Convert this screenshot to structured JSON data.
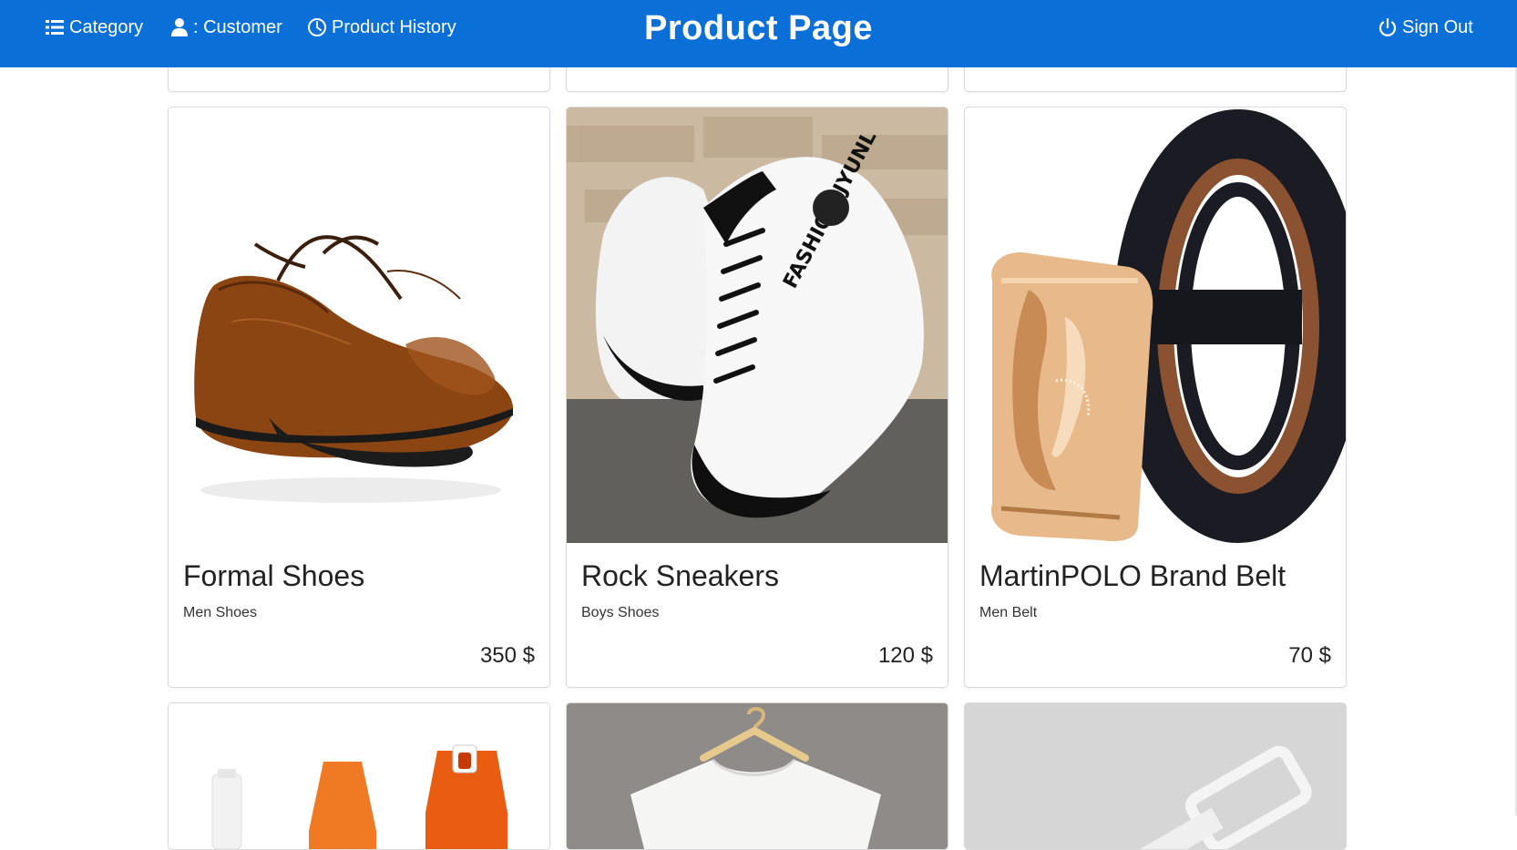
{
  "header": {
    "title": "Product Page",
    "nav": {
      "category": "Category",
      "customer": ": Customer",
      "history": "Product History",
      "signout": "Sign Out"
    },
    "background_color": "#0a6fd6"
  },
  "products": [
    {
      "name": "Formal Shoes",
      "category": "Men Shoes",
      "price": "350 $",
      "image_icon": "brown-leather-shoe"
    },
    {
      "name": "Rock Sneakers",
      "category": "Boys Shoes",
      "price": "120 $",
      "image_icon": "white-high-top-sneaker"
    },
    {
      "name": "MartinPOLO Brand Belt",
      "category": "Men Belt",
      "price": "70 $",
      "image_icon": "black-leather-belt"
    }
  ],
  "partial_cards": [
    {
      "image_icon": "orange-spray-bottles"
    },
    {
      "image_icon": "white-tshirt-on-hanger"
    },
    {
      "image_icon": "white-belt-buckle"
    }
  ]
}
